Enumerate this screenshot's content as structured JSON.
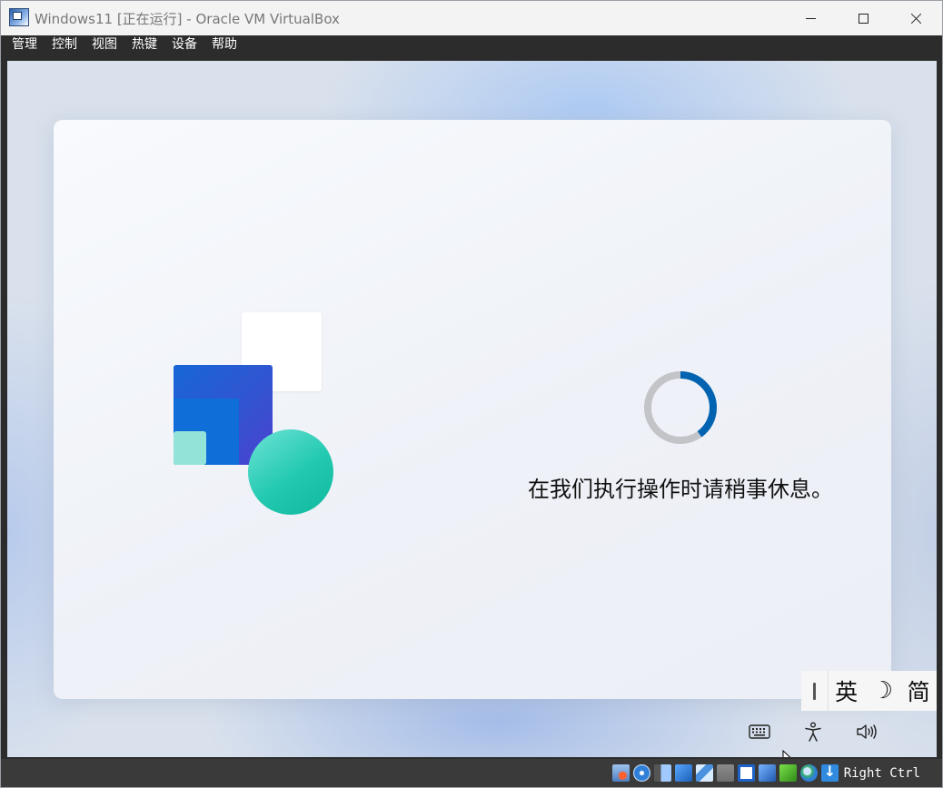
{
  "window": {
    "title": "Windows11 [正在运行] - Oracle VM VirtualBox"
  },
  "menubar": {
    "items": [
      "管理",
      "控制",
      "视图",
      "热键",
      "设备",
      "帮助"
    ]
  },
  "oobe": {
    "status_text": "在我们执行操作时请稍事休息。",
    "spinner_progress": 0.4,
    "spinner_color": "#0063b1",
    "spinner_track_color": "#c2c4c8"
  },
  "ime": {
    "mode_label": "英",
    "moon_glyph": "☽",
    "script_label": "简"
  },
  "system_icons": [
    "keyboard-icon",
    "accessibility-icon",
    "volume-icon"
  ],
  "statusbar": {
    "icons": [
      "hard-disk-icon",
      "optical-drive-icon",
      "audio-icon",
      "network-icon",
      "usb-icon",
      "shared-folder-icon",
      "display-icon",
      "recording-icon",
      "vt-x-icon",
      "mouse-integration-icon",
      "download-icon"
    ],
    "host_key": "Right Ctrl"
  }
}
